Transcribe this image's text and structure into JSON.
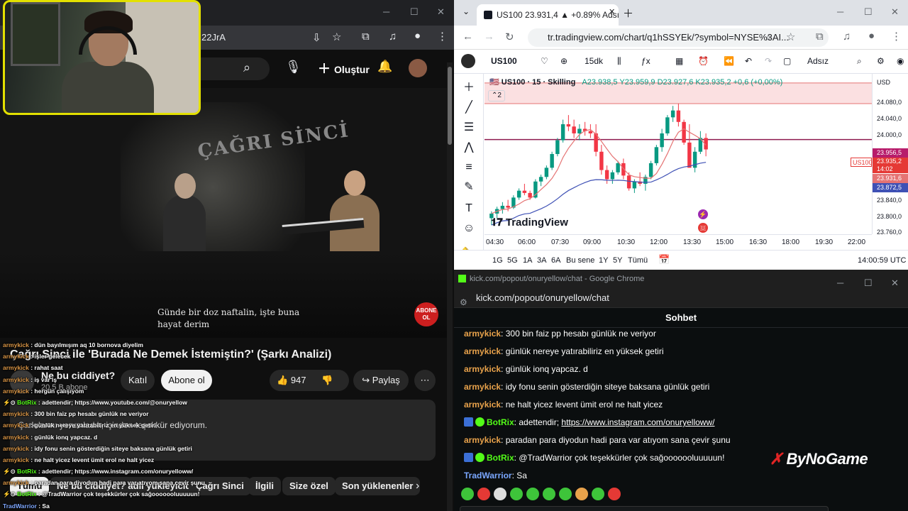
{
  "youtube": {
    "url_fragment": "22JrA",
    "create_label": "Oluştur",
    "video_subtitle_line1": "Günde bir doz naftalin, işte buna",
    "video_subtitle_line2": "hayat derim",
    "video_overlay_text": "ÇAĞRI SİNCİ",
    "abone_badge": "ABONE OL",
    "title": "Çağrı Sinci ile 'Burada Ne Demek İstemiştin?' (Şarkı Analizi)",
    "channel_name": "Ne bu ciddiyet?",
    "channel_subs": "20,5 B abone",
    "join_label": "Katıl",
    "subscribe_label": "Abone ol",
    "like_count": "947",
    "share_label": "Paylaş",
    "description": "Şarkılarını yorumladık, içinden teşekkür ediyorum.",
    "chips": [
      "Tümü",
      "Ne bu ciddiyet? adlı yükleyiciden",
      "Çağrı Sinci",
      "İlgili",
      "Size özel",
      "Son yüklenenler"
    ]
  },
  "stream_overlay_chat": [
    {
      "user": "armykick",
      "type": "user",
      "text": "dün bayılmışım aq 10 bornova diyelim"
    },
    {
      "user": "armykick",
      "type": "user",
      "text": "işler gelecek"
    },
    {
      "user": "armykick",
      "type": "user",
      "text": "rahat saat"
    },
    {
      "user": "armykick",
      "type": "user",
      "text": "iş var iş"
    },
    {
      "user": "armykick",
      "type": "user",
      "text": "hergün çalışıyom"
    },
    {
      "user": "BotRix",
      "type": "bot",
      "text": "adettendir; https://www.youtube.com/@onuryellow"
    },
    {
      "user": "armykick",
      "type": "user",
      "text": "300 bin faiz pp hesabı günlük ne veriyor"
    },
    {
      "user": "armykick",
      "type": "user",
      "text": "günlük nereye yatırabiliriz en yüksek getiri"
    },
    {
      "user": "armykick",
      "type": "user",
      "text": "günlük ionq yapcaz. d"
    },
    {
      "user": "armykick",
      "type": "user",
      "text": "idy fonu senin gösterdiğin siteye baksana günlük getiri"
    },
    {
      "user": "armykick",
      "type": "user",
      "text": "ne halt yicez levent ümit erol ne halt yicez"
    },
    {
      "user": "BotRix",
      "type": "bot",
      "text": "adettendir; https://www.instagram.com/onuryelloww/"
    },
    {
      "user": "armykick",
      "type": "user",
      "text": "paradan para diyodun hadi para var atıyom sana çevir şunu"
    },
    {
      "user": "BotRix",
      "type": "bot",
      "text": "@TradWarrior çok teşekkürler çok sağooooooluuuuun!"
    },
    {
      "user": "TradWarrior",
      "type": "user2",
      "text": "Sa"
    }
  ],
  "tradingview": {
    "tab_title": "US100 23.931,4 ▲ +0.89% Adsız",
    "url": "tr.tradingview.com/chart/q1hSSYEk/?symbol=NYSE%3AI...",
    "symbol": "US100",
    "interval": "15dk",
    "layout_name": "Adsız",
    "legend_title": "US100 · 15 · Skilling",
    "legend_ohlc": "A23.938,5  Y23.959,9  D23.927,6  K23.935,2  +0,6 (+0,00%)",
    "legend_sub": "2",
    "logo": "TradingView",
    "currency": "USD",
    "y_labels": [
      "24.080,0",
      "24.040,0",
      "24.000,0",
      "23.960,0",
      "23.920,0",
      "23.880,0",
      "23.840,0",
      "23.800,0",
      "23.760,0"
    ],
    "price_tags": {
      "line": "23.956,5",
      "last": "23.935,2",
      "countdown": "14:02",
      "ma": "23.931,6",
      "ma2": "23.872,5",
      "symbol_tag": "US100"
    },
    "x_labels": [
      "04:30",
      "06:00",
      "07:30",
      "09:00",
      "10:30",
      "12:00",
      "13:30",
      "15:00",
      "16:30",
      "18:00",
      "19:30",
      "22:00"
    ],
    "ranges": [
      "1G",
      "5G",
      "1A",
      "3A",
      "6A",
      "Bu sene",
      "1Y",
      "5Y",
      "Tümü"
    ],
    "clock": "14:00:59 UTC",
    "colors": {
      "up": "#089981",
      "down": "#f23645",
      "ma_red": "#e57373",
      "ma_blue": "#3f51b5",
      "zone": "#f7c6c9"
    }
  },
  "chart_data": {
    "type": "candlestick",
    "title": "US100 · 15 · Skilling",
    "ylim": [
      23750,
      24100
    ],
    "candles": [
      [
        23785,
        23800,
        23770,
        23795
      ],
      [
        23795,
        23810,
        23785,
        23805
      ],
      [
        23805,
        23820,
        23795,
        23812
      ],
      [
        23812,
        23825,
        23800,
        23808
      ],
      [
        23808,
        23835,
        23805,
        23830
      ],
      [
        23830,
        23850,
        23825,
        23845
      ],
      [
        23845,
        23860,
        23835,
        23840
      ],
      [
        23840,
        23845,
        23825,
        23830
      ],
      [
        23830,
        23870,
        23828,
        23865
      ],
      [
        23865,
        23880,
        23855,
        23875
      ],
      [
        23875,
        23900,
        23870,
        23895
      ],
      [
        23895,
        23930,
        23890,
        23925
      ],
      [
        23925,
        23960,
        23920,
        23955
      ],
      [
        23955,
        24000,
        23950,
        23990
      ],
      [
        23990,
        24010,
        23975,
        23985
      ],
      [
        23985,
        24000,
        23960,
        23970
      ],
      [
        23970,
        23990,
        23955,
        23980
      ],
      [
        23980,
        23995,
        23965,
        23975
      ],
      [
        23975,
        23990,
        23960,
        23970
      ],
      [
        23970,
        23990,
        23920,
        23930
      ],
      [
        23930,
        23945,
        23880,
        23890
      ],
      [
        23890,
        23900,
        23860,
        23870
      ],
      [
        23870,
        23890,
        23860,
        23885
      ],
      [
        23885,
        23910,
        23880,
        23905
      ],
      [
        23905,
        23915,
        23870,
        23878
      ],
      [
        23878,
        23885,
        23845,
        23850
      ],
      [
        23850,
        23870,
        23840,
        23865
      ],
      [
        23865,
        23885,
        23855,
        23860
      ],
      [
        23860,
        23880,
        23845,
        23875
      ],
      [
        23875,
        23910,
        23870,
        23905
      ],
      [
        23905,
        23945,
        23900,
        23940
      ],
      [
        23940,
        23980,
        23930,
        23970
      ],
      [
        23970,
        24010,
        23965,
        24005
      ],
      [
        24005,
        24030,
        23995,
        24020
      ],
      [
        24020,
        24035,
        23985,
        23995
      ],
      [
        23995,
        24000,
        23945,
        23950
      ],
      [
        23950,
        23990,
        23900,
        23895
      ],
      [
        23895,
        23940,
        23885,
        23930
      ],
      [
        23930,
        23975,
        23925,
        23960
      ],
      [
        23960,
        23970,
        23920,
        23935
      ]
    ],
    "hline": 23956.5,
    "zone": [
      24035,
      24080
    ]
  },
  "kick": {
    "window_title": "kick.com/popout/onuryellow/chat - Google Chrome",
    "url": "kick.com/popout/onuryellow/chat",
    "header": "Sohbet",
    "messages": [
      {
        "user": "armykick",
        "type": "user",
        "text": "300 bin faiz pp hesabı günlük ne veriyor"
      },
      {
        "user": "armykick",
        "type": "user",
        "text": "günlük nereye yatırabiliriz en yüksek getiri"
      },
      {
        "user": "armykick",
        "type": "user",
        "text": "günlük ionq yapcaz. d"
      },
      {
        "user": "armykick",
        "type": "user",
        "text": "idy fonu senin gösterdiğin siteye baksana günlük getiri"
      },
      {
        "user": "armykick",
        "type": "user",
        "text": "ne halt yicez levent ümit erol ne halt yicez"
      },
      {
        "user": "BotRix",
        "type": "bot",
        "text": "adettendir; ",
        "link": "https://www.instagram.com/onuryelloww/"
      },
      {
        "user": "armykick",
        "type": "user",
        "text": "paradan para diyodun hadi para var atıyom sana çevir şunu"
      },
      {
        "user": "BotRix",
        "type": "bot",
        "text": "@TradWarrior çok teşekkürler çok sağooooooluuuuun!"
      },
      {
        "user": "TradWarrior",
        "type": "user2",
        "text": "Sa"
      }
    ],
    "sponsor_logo": "ByNoGame"
  }
}
